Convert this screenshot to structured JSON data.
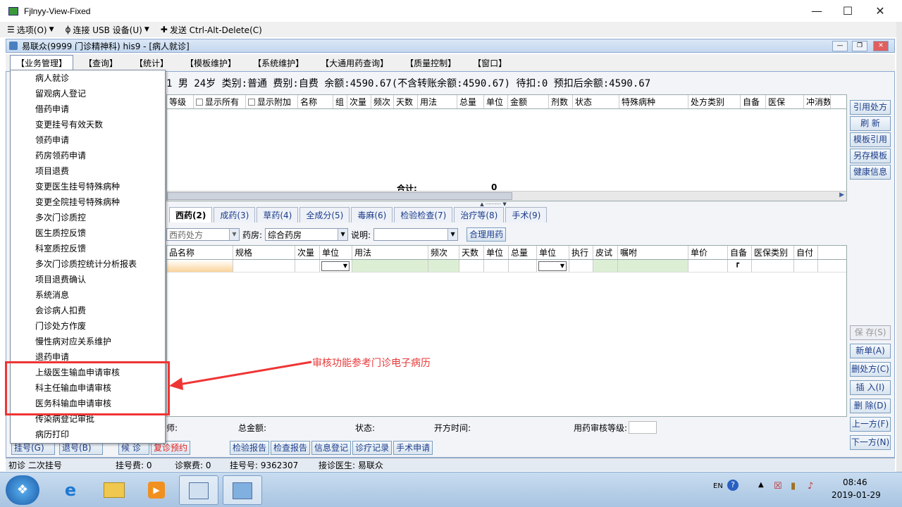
{
  "vm": {
    "title": "Fjlnyy-View-Fixed",
    "toolbar": {
      "options": "选项(O)",
      "usb": "连接 USB 设备(U)",
      "send": "发送 Ctrl-Alt-Delete(C)"
    }
  },
  "app": {
    "title": "易联众(9999 门诊精神科) his9 - [病人就诊]",
    "menus": [
      "【业务管理】",
      "【查询】",
      "【统计】",
      "【模板维护】",
      "【系统维护】",
      "【大通用药查询】",
      "【质量控制】",
      "【窗口】"
    ]
  },
  "dropdown": {
    "items": [
      "病人就诊",
      "留观病人登记",
      "借药申请",
      "变更挂号有效天数",
      "领药申请",
      "药房领药申请",
      "项目退费",
      "变更医生挂号特殊病种",
      "变更全院挂号特殊病种",
      "多次门诊质控",
      "医生质控反馈",
      "科室质控反馈",
      "多次门诊质控统计分析报表",
      "项目退费确认",
      "系统消息",
      "会诊病人扣费",
      "门诊处方作废",
      "慢性病对应关系维护",
      "退药申请",
      "上级医生输血申请审核",
      "科主任输血申请审核",
      "医务科输血申请审核",
      "传染病登记审批",
      "病历打印"
    ]
  },
  "annotation": "审核功能参考门诊电子病历",
  "patient_info": "1 男 24岁 类别:普通 费别:自费 余额:4590.67(不含转账余额:4590.67) 待扣:0 预扣后余额:4590.67",
  "top_grid": {
    "headers": [
      "等级",
      "显示所有",
      "显示附加",
      "名称",
      "组",
      "次量",
      "频次",
      "天数",
      "用法",
      "总量",
      "单位",
      "金额",
      "剂数",
      "状态",
      "特殊病种",
      "处方类别",
      "自备",
      "医保",
      "冲消数"
    ],
    "total_label": "合计:",
    "total_value": "0"
  },
  "right_buttons_top": [
    "引用处方",
    "刷 新",
    "模板引用",
    "另存模板",
    "健康信息"
  ],
  "right_buttons_bottom": [
    "保 存(S)",
    "新单(A)",
    "删处方(C)",
    "插 入(I)",
    "删 除(D)",
    "上一方(F)",
    "下一方(N)"
  ],
  "tabs": [
    "西药(2)",
    "成药(3)",
    "草药(4)",
    "全成分(5)",
    "毒麻(6)",
    "检验检查(7)",
    "治疗等(8)",
    "手术(9)"
  ],
  "rx_toolbar": {
    "rx_type": "西药处方",
    "pharmacy_label": "药房:",
    "pharmacy_value": "综合药房",
    "note_label": "说明:",
    "note_value": "",
    "rational_button": "合理用药"
  },
  "bottom_grid": {
    "headers": [
      "品名称",
      "规格",
      "次量",
      "单位",
      "用法",
      "频次",
      "天数",
      "单位",
      "总量",
      "单位",
      "执行",
      "皮试",
      "嘱咐",
      "单价",
      "自备",
      "医保类别",
      "自付"
    ]
  },
  "summary": {
    "fee_label": "师:",
    "total_label": "总金额:",
    "status_label": "状态:",
    "time_label": "开方时间:",
    "audit_label": "用药审核等级:"
  },
  "bottom_buttons": [
    "候 诊",
    "复诊预约",
    "检验报告",
    "检查报告",
    "信息登记",
    "诊疗记录",
    "手术申请"
  ],
  "hidden_left_buttons": [
    "挂号(G)",
    "退号(B)"
  ],
  "statusbar": {
    "visit": "初诊 二次挂号",
    "reg_fee": "挂号费: 0",
    "exam_fee": "诊察费: 0",
    "reg_no": "挂号号: 9362307",
    "doctor": "接诊医生: 易联众"
  },
  "taskbar": {
    "lang": "EN",
    "time": "08:46",
    "date": "2019-01-29"
  }
}
